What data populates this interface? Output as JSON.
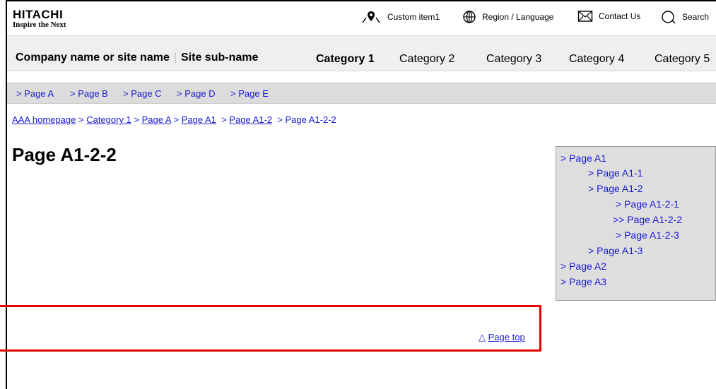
{
  "header": {
    "brand": "HITACHI",
    "tagline": "Inspire the Next",
    "utility": {
      "custom": "Custom item1",
      "region": "Region / Language",
      "contact": "Contact Us",
      "search": "Search"
    }
  },
  "nav": {
    "site_name": "Company name or site name",
    "site_sub": "Site sub-name",
    "categories": [
      "Category 1",
      "Category 2",
      "Category 3",
      "Category 4",
      "Category 5"
    ],
    "active_category": "Category 1"
  },
  "subnav": [
    "> Page A",
    "> Page B",
    "> Page C",
    "> Page D",
    "> Page E"
  ],
  "breadcrumb": {
    "items": [
      "AAA homepage",
      "Category 1",
      "Page A",
      "Page A1",
      "Page A1-2"
    ],
    "separator": ">",
    "current": "Page A1-2-2"
  },
  "page": {
    "title": "Page A1-2-2"
  },
  "side_nav": [
    {
      "label": "> Page A1"
    },
    {
      "label": "> Page A1-1"
    },
    {
      "label": "> Page A1-2"
    },
    {
      "label": "> Page A1-2-1"
    },
    {
      "label": ">> Page A1-2-2",
      "current": true
    },
    {
      "label": "> Page A1-2-3"
    },
    {
      "label": "> Page A1-3"
    },
    {
      "label": "> Page A2"
    },
    {
      "label": "> Page A3"
    }
  ],
  "footer": {
    "page_top_icon": "△",
    "page_top": "Page top"
  },
  "colors": {
    "link": "#1a1ad6",
    "highlight": "#e60000",
    "nav_bg": "#efefef",
    "subnav_bg": "#dcdcdc",
    "side_bg": "#dedede"
  }
}
